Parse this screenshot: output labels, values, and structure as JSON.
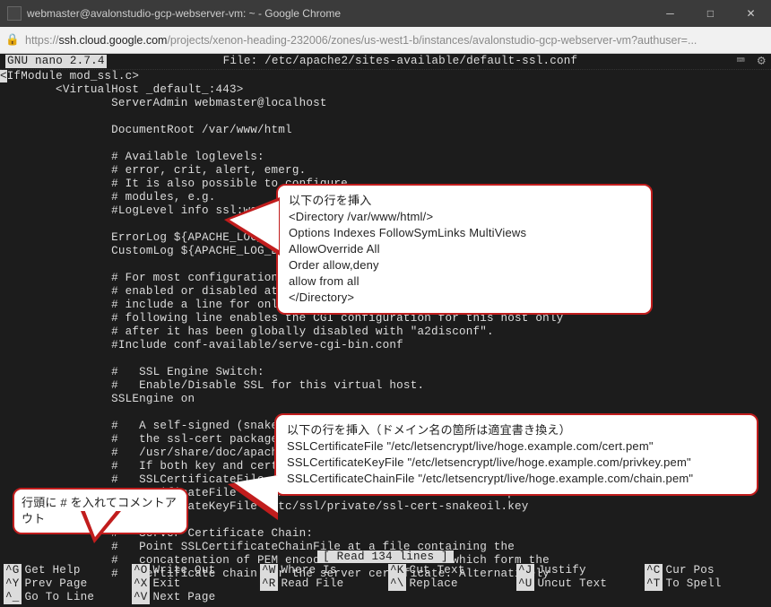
{
  "window": {
    "title": "webmaster@avalonstudio-gcp-webserver-vm: ~ - Google Chrome"
  },
  "address": {
    "scheme": "https://",
    "host": "ssh.cloud.google.com",
    "path": "/projects/xenon-heading-232006/zones/us-west1-b/instances/avalonstudio-gcp-webserver-vm?authuser=..."
  },
  "nano": {
    "version": "  GNU nano 2.7.4  ",
    "file_label": "File: /etc/apache2/sites-available/default-ssl.conf",
    "status": "[ Read 134 lines ]",
    "keys": [
      {
        "k": "^G",
        "label": "Get Help"
      },
      {
        "k": "^O",
        "label": "Write Out"
      },
      {
        "k": "^W",
        "label": "Where Is"
      },
      {
        "k": "^K",
        "label": "Cut Text"
      },
      {
        "k": "^J",
        "label": "Justify"
      },
      {
        "k": "^C",
        "label": "Cur Pos"
      },
      {
        "k": "^Y",
        "label": "Prev Page"
      },
      {
        "k": "^X",
        "label": "Exit"
      },
      {
        "k": "^R",
        "label": "Read File"
      },
      {
        "k": "^\\",
        "label": "Replace"
      },
      {
        "k": "^U",
        "label": "Uncut Text"
      },
      {
        "k": "^T",
        "label": "To Spell"
      },
      {
        "k": "^_",
        "label": "Go To Line"
      },
      {
        "k": "^V",
        "label": "Next Page"
      }
    ]
  },
  "editor_lines": {
    "l00a": "<",
    "l00b": "IfModule mod_ssl.c>",
    "l01": "        <VirtualHost _default_:443>",
    "l02": "                ServerAdmin webmaster@localhost",
    "l03": "",
    "l04": "                DocumentRoot /var/www/html",
    "l05": "",
    "l06": "                # Available loglevels:",
    "l07": "                # error, crit, alert, emerg.",
    "l08": "                # It is also possible to configure",
    "l09": "                # modules, e.g.",
    "l10": "                #LogLevel info ssl:warn",
    "l11": "",
    "l12": "                ErrorLog ${APACHE_LOG_DIR}/error.log",
    "l13": "                CustomLog ${APACHE_LOG_DIR}/access.log combined",
    "l14": "",
    "l15": "                # For most configuration files from conf-available/, which are",
    "l16": "                # enabled or disabled at a global level, it is possible to",
    "l17": "                # include a line for only one particular virtual host. For example the",
    "l18": "                # following line enables the CGI configuration for this host only",
    "l19": "                # after it has been globally disabled with \"a2disconf\".",
    "l20": "                #Include conf-available/serve-cgi-bin.conf",
    "l21": "",
    "l22": "                #   SSL Engine Switch:",
    "l23": "                #   Enable/Disable SSL for this virtual host.",
    "l24": "                SSLEngine on",
    "l25": "",
    "l26": "                #   A self-signed (snakeoil)",
    "l27": "                #   the ssl-cert package. See",
    "l28": "                #   /usr/share/doc/apache2/README.Debian.gz for more info.",
    "l29": "                #   If both key and certificate are stored in the same file, only the",
    "l30": "                #   SSLCertificateFile directive is needed.",
    "l31": "                SSLCertificateFile      /etc/ssl/certs/ssl-cert-snakeoil.pem",
    "l32": "                SSLCertificateKeyFile /etc/ssl/private/ssl-cert-snakeoil.key",
    "l33": "",
    "l34": "                #   Server Certificate Chain:",
    "l35": "                #   Point SSLCertificateChainFile at a file containing the",
    "l36": "                #   concatenation of PEM encoded CA certificates which form the",
    "l37": "                #   certificate chain for the server certificate. Alternatively"
  },
  "callouts": {
    "c1": {
      "jp": "以下の行を挿入",
      "l1": "<Directory /var/www/html/>",
      "l2": "  Options Indexes FollowSymLinks MultiViews",
      "l3": "  AllowOverride All",
      "l4": "  Order allow,deny",
      "l5": "  allow from all",
      "l6": "</Directory>"
    },
    "c2": {
      "jp": "以下の行を挿入（ドメイン名の箇所は適宜書き換え）",
      "l1": "SSLCertificateFile \"/etc/letsencrypt/live/hoge.example.com/cert.pem\"",
      "l2": "SSLCertificateKeyFile \"/etc/letsencrypt/live/hoge.example.com/privkey.pem\"",
      "l3": "SSLCertificateChainFile \"/etc/letsencrypt/live/hoge.example.com/chain.pem\""
    },
    "c3": {
      "jp": "行頭に # を入れてコメントアウト"
    }
  }
}
